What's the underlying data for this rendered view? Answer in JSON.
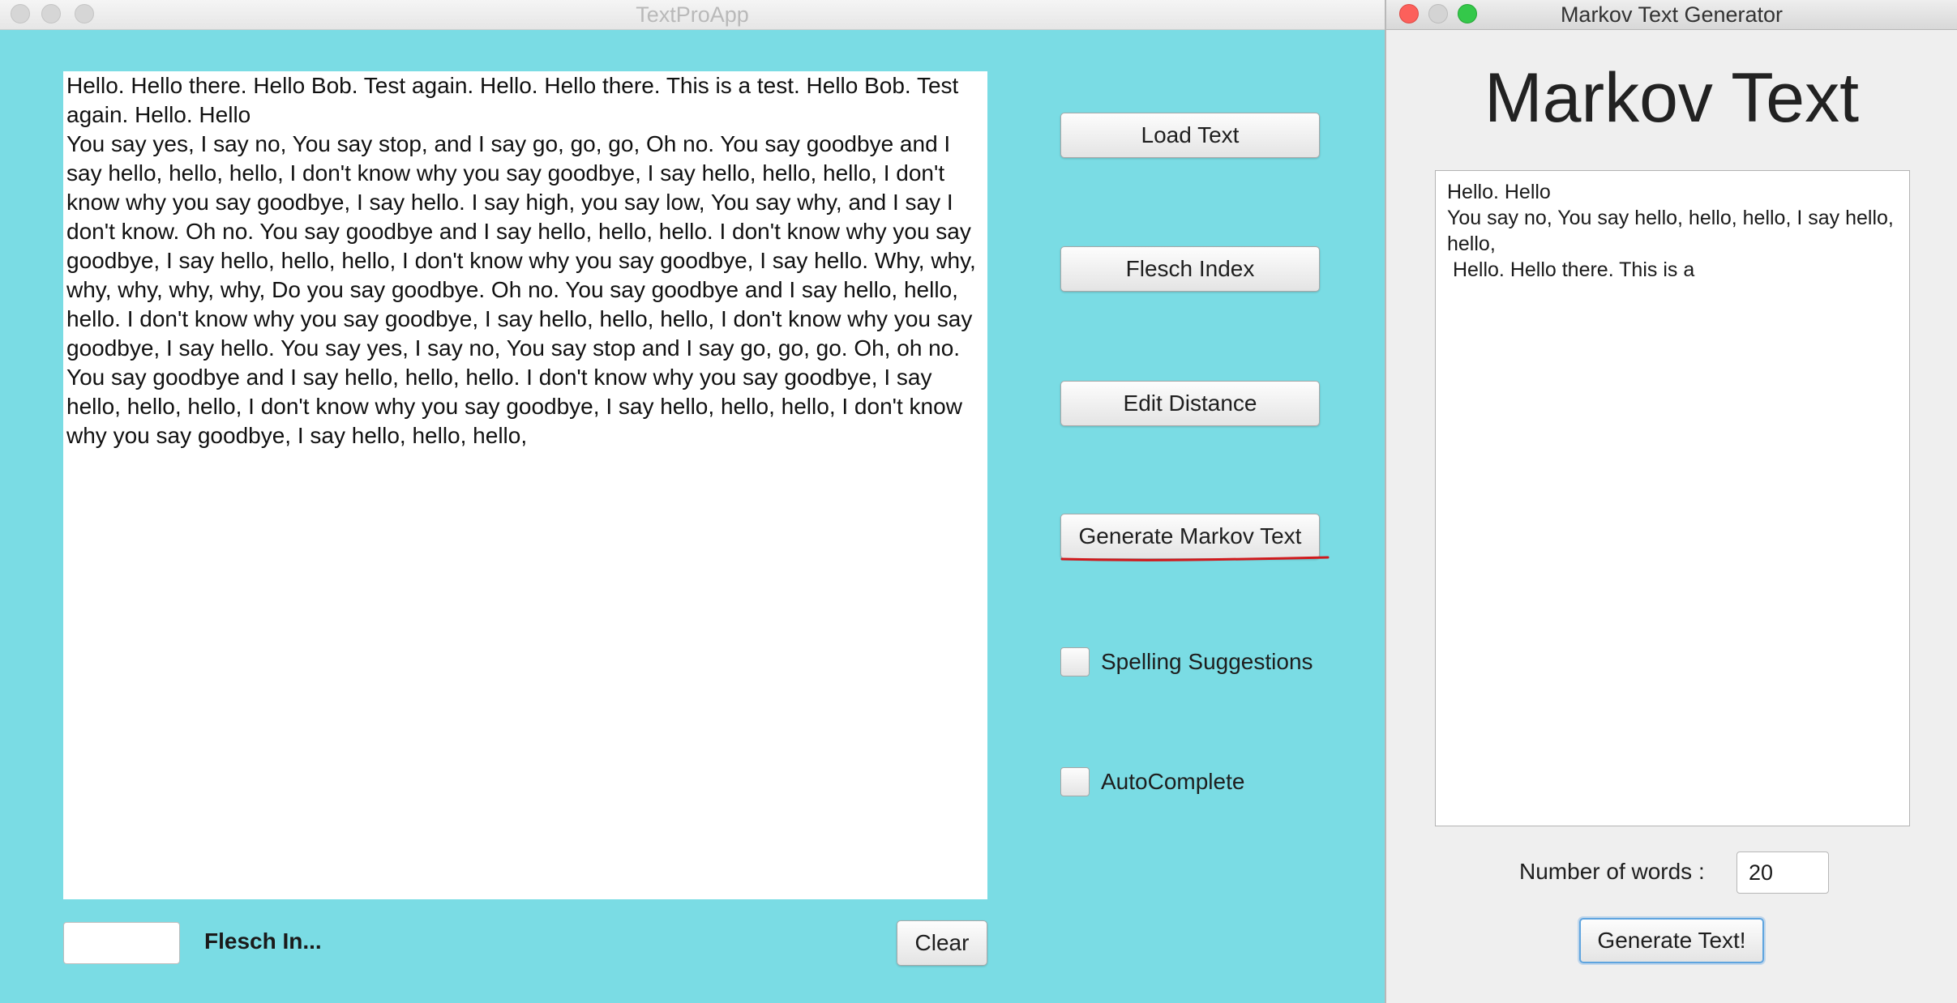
{
  "main_window": {
    "title": "TextProApp",
    "editor_paragraphs": [
      "Hello. Hello there. Hello Bob. Test again. Hello. Hello there. This is a test. Hello Bob. Test again. Hello. Hello",
      "You say yes, I say no, You say stop, and I say go, go, go, Oh no. You say goodbye and I say hello, hello, hello, I don't know why you say goodbye, I say hello, hello, hello, I don't know why you say goodbye, I say hello. I say high, you say low, You say why, and I say I don't know. Oh no. You say goodbye and I say hello, hello, hello. I don't know why you say goodbye, I say hello, hello, hello, I don't know why you say goodbye, I say hello. Why, why, why, why, why, why, Do you say goodbye. Oh no. You say goodbye and I say hello, hello, hello. I don't know why you say goodbye, I say hello, hello, hello, I don't know why you say goodbye, I say hello. You say yes, I say no, You say stop and I say go, go, go. Oh, oh no. You say goodbye and I say hello, hello, hello. I don't know why you say goodbye, I say hello, hello, hello, I don't know why you say goodbye, I say hello, hello, hello, I don't know why you say goodbye, I say hello, hello, hello,"
    ],
    "buttons": {
      "load_text": "Load Text",
      "flesch_index": "Flesch Index",
      "edit_distance": "Edit Distance",
      "generate_markov": "Generate Markov Text",
      "clear": "Clear"
    },
    "checkboxes": {
      "spelling": "Spelling Suggestions",
      "autocomplete": "AutoComplete"
    },
    "flesch_label": "Flesch In...",
    "flesch_value": ""
  },
  "markov_window": {
    "title": "Markov Text Generator",
    "heading": "Markov Text",
    "output_lines": [
      "Hello. Hello",
      "You say no, You say hello, hello, hello, I say hello, hello,",
      " Hello. Hello there. This is a"
    ],
    "num_words_label": "Number of words :",
    "num_words_value": "20",
    "generate_button": "Generate Text!"
  },
  "colors": {
    "main_background": "#7adce4",
    "annotation_underline": "#d0191c",
    "close_button": "#fc605b",
    "zoom_button": "#34c84a"
  }
}
